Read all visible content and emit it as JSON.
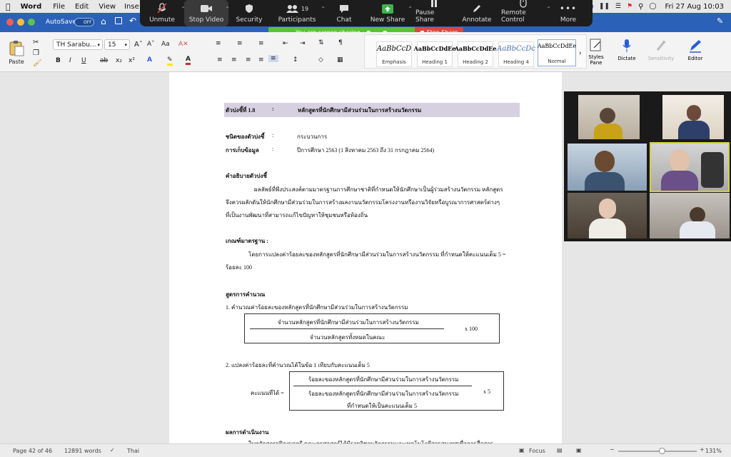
{
  "menubar": {
    "app": "Word",
    "items": [
      "File",
      "Edit",
      "View",
      "Inse"
    ],
    "clock": "Fri 27 Aug  10:03"
  },
  "zoom": {
    "buttons": [
      {
        "label": "Unmute",
        "icon": "microphone-muted-icon"
      },
      {
        "label": "Stop Video",
        "icon": "video-camera-icon"
      },
      {
        "label": "Security",
        "icon": "shield-icon"
      },
      {
        "label": "Participants",
        "icon": "participants-icon",
        "count": "19"
      },
      {
        "label": "Chat",
        "icon": "chat-bubble-icon"
      },
      {
        "label": "New Share",
        "icon": "share-screen-icon"
      },
      {
        "label": "Pause Share",
        "icon": "pause-icon"
      },
      {
        "label": "Annotate",
        "icon": "pencil-icon"
      },
      {
        "label": "Remote Control",
        "icon": "mouse-icon"
      },
      {
        "label": "More",
        "icon": "ellipsis-icon"
      }
    ],
    "sharing_banner": "You are screen sharing",
    "stop_share": "Stop Share"
  },
  "word": {
    "autosave_label": "AutoSave",
    "autosave_state": "OFF"
  },
  "ribbon": {
    "paste_label": "Paste",
    "font_name": "TH Sarabu...",
    "font_size": "15",
    "styles": [
      {
        "preview": "AaBbCcD",
        "name": "Emphasis"
      },
      {
        "preview": "AaBbCcDdEe",
        "name": "Heading 1"
      },
      {
        "preview": "AaBbCcDdEe",
        "name": "Heading 2"
      },
      {
        "preview": "AaBbCcDc",
        "name": "Heading 4"
      },
      {
        "preview": "AaBbCcDdEe",
        "name": "Normal"
      }
    ],
    "styles_pane": "Styles\nPane",
    "dictate": "Dictate",
    "sensitivity": "Sensitivity",
    "editor": "Editor"
  },
  "document": {
    "indicator_label": "ตัวบ่งชี้ที่ 1.8",
    "indicator_colon": ":",
    "indicator_title": "หลักสูตรที่นักศึกษามีส่วนร่วมในการสร้างนวัตกรรม",
    "type_label": "ชนิดของตัวบ่งชี้",
    "type_colon": ":",
    "type_value": "กระบวนการ",
    "collect_label": "การเก็บข้อมูล",
    "collect_colon": ":",
    "collect_value": "ปีการศึกษา 2563 (1 สิงหาคม 2563 ถึง 31 กรกฎาคม 2564)",
    "desc_heading": "คำอธิบายตัวบ่งชี้",
    "desc_line1": "ผลลัพธ์ที่พึงประสงค์ตามมาตรฐานการศึกษาชาติที่กำหนดให้นักศึกษาเป็นผู้ร่วมสร้างนวัตกรรม หลักสูตร",
    "desc_line2": "จึงควรผลักดันให้นักศึกษามีส่วนร่วมในการสร้างผลงานนวัตกรรมโครงงานหรืองานวิจัยหรือบูรณาการศาสตร์ต่างๆ",
    "desc_line3": "ที่เป็นงานพัฒนาที่สามารถแก้ไขปัญหาให้ชุมชนหรือท้องถิ่น",
    "criteria_heading": "เกณฑ์มาตรฐาน  :",
    "criteria_line1": "โดยการแปลงค่าร้อยละของหลักสูตรที่นักศึกษามีส่วนร่วมในการสร้างนวัตกรรม ที่กำหนดให้คะแนนเต็ม 5 =",
    "criteria_line2": "ร้อยละ 100",
    "formula_heading": "สูตรการคำนวณ",
    "formula1_intro": "1. คำนวณค่าร้อยละของหลักสูตรที่นักศึกษามีส่วนร่วมในการสร้างนวัตกรรม",
    "formula1_num": "จำนวนหลักสูตรที่นักศึกษามีส่วนร่วมในการสร้างนวัตกรรม",
    "formula1_den": "จำนวนหลักสูตรทั้งหมดในคณะ",
    "formula1_mult": "x 100",
    "formula2_intro": "2. แปลงค่าร้อยละที่คำนวณได้ในข้อ 1 เทียบกับคะแนนเต็ม 5",
    "formula2_label": "คะแนนที่ได้ =",
    "formula2_num": "ร้อยละของหลักสูตรที่นักศึกษามีส่วนร่วมในการสร้างนวัตกรรม",
    "formula2_den1": "ร้อยละของหลักสูตรที่นักศึกษามีส่วนร่วมในการสร้างนวัตกรรม",
    "formula2_den2": "ที่กำหนดให้เป็นคะแนนเต็ม 5",
    "formula2_mult": "x 5",
    "result_heading": "ผลการดำเนินงาน",
    "result_line1": "ในหลักสูตรปริญญาตรี คณะครุศาสตร์ได้มีรายวิชานวัตกรรมและเทคโนโลยีสารสนเทศเพื่อการสื่อสาร"
  },
  "status": {
    "page": "Page 42 of 46",
    "words": "12891 words",
    "language": "Thai",
    "focus": "Focus",
    "zoom_value": "131%",
    "zoom_level": 0.55
  }
}
